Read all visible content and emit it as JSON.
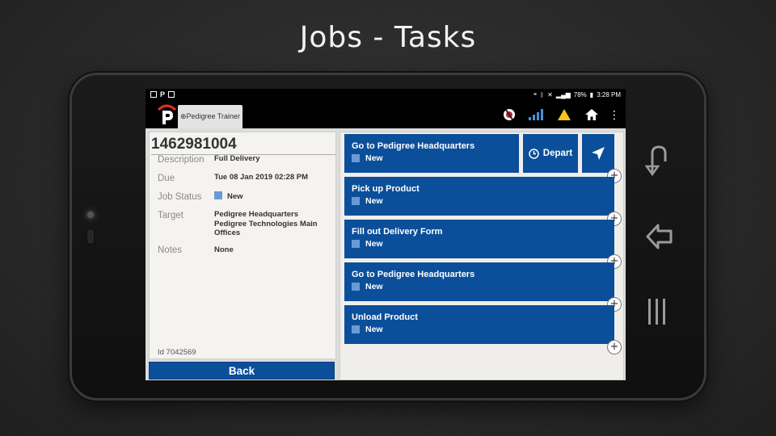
{
  "slide": {
    "title": "Jobs - Tasks"
  },
  "status_bar": {
    "battery": "78%",
    "time": "3:28 PM"
  },
  "app_bar": {
    "tab_label": "⊕Pedigree Trainer"
  },
  "job": {
    "number": "1462981004",
    "fields": [
      {
        "label": "Description",
        "value": "Full Delivery"
      },
      {
        "label": "Due",
        "value": "Tue 08 Jan 2019 02:28 PM"
      },
      {
        "label": "Job Status",
        "value": "New"
      },
      {
        "label": "Target",
        "value": "Pedigree Headquarters Pedigree Technologies Main Offices"
      },
      {
        "label": "Notes",
        "value": "None"
      }
    ],
    "id_line": "Id 7042569",
    "back_label": "Back"
  },
  "tasks": [
    {
      "title": "Go to Pedigree Headquarters",
      "status": "New"
    },
    {
      "title": "Pick up Product",
      "status": "New"
    },
    {
      "title": "Fill out Delivery Form",
      "status": "New"
    },
    {
      "title": "Go to Pedigree Headquarters",
      "status": "New"
    },
    {
      "title": "Unload Product",
      "status": "New"
    }
  ],
  "actions": {
    "depart_label": "Depart",
    "add_symbol": "+"
  },
  "colors": {
    "primary": "#0b4f9b",
    "status_new": "#6a9ad6",
    "warning": "#f5c518"
  }
}
